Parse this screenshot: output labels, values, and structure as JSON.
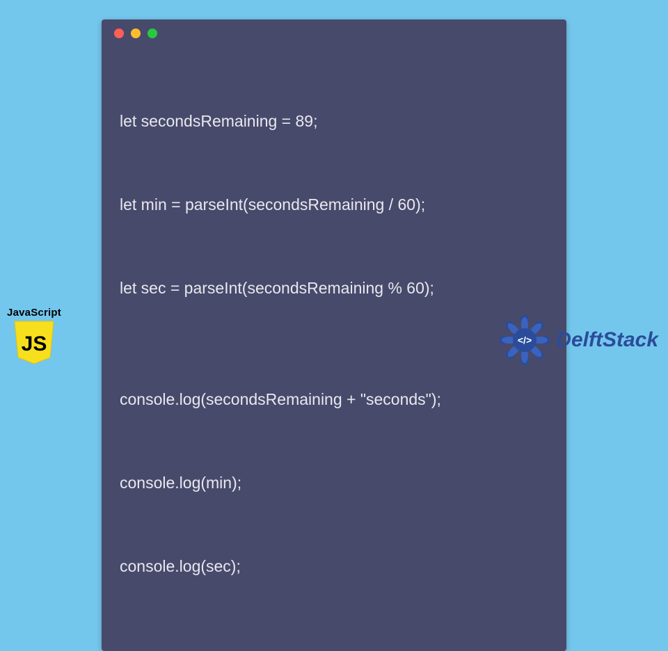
{
  "code": {
    "lines": [
      "let secondsRemaining = 89;",
      "let min = parseInt(secondsRemaining / 60);",
      "let sec = parseInt(secondsRemaining % 60);",
      "",
      "console.log(secondsRemaining + \"seconds\");",
      "console.log(min);",
      "console.log(sec);"
    ]
  },
  "js_badge": {
    "label": "JavaScript",
    "glyph": "JS"
  },
  "brand": {
    "name": "DelftStack",
    "glyph": "</>"
  },
  "colors": {
    "page_bg": "#74c7ec",
    "window_bg": "#484a6b",
    "code_text": "#e8e8f0",
    "dot_red": "#ff5f56",
    "dot_yellow": "#ffbd2e",
    "dot_green": "#27c93f",
    "js_yellow": "#f7df1e",
    "brand_blue": "#2a4c9b"
  }
}
